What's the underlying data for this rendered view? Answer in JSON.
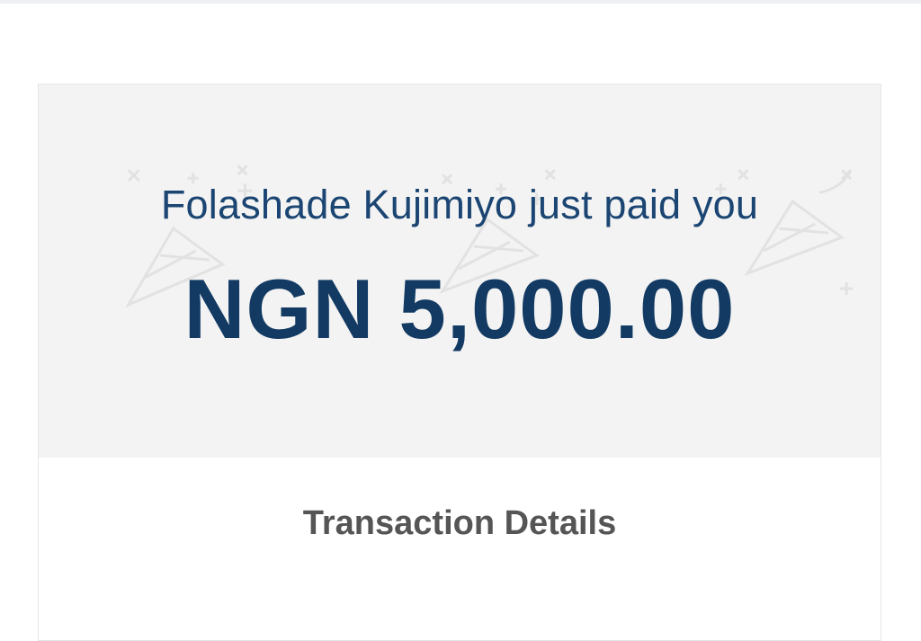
{
  "notification": {
    "payer_message": "Folashade Kujimiyo just paid you",
    "amount": "NGN 5,000.00"
  },
  "details": {
    "title": "Transaction Details"
  },
  "colors": {
    "primary_text": "#1b4572",
    "amount_text": "#123a63",
    "hero_background": "#f3f3f3",
    "section_title": "#555555"
  },
  "icons": [
    "party-popper-icon",
    "sparkle-icon",
    "star-icon"
  ]
}
